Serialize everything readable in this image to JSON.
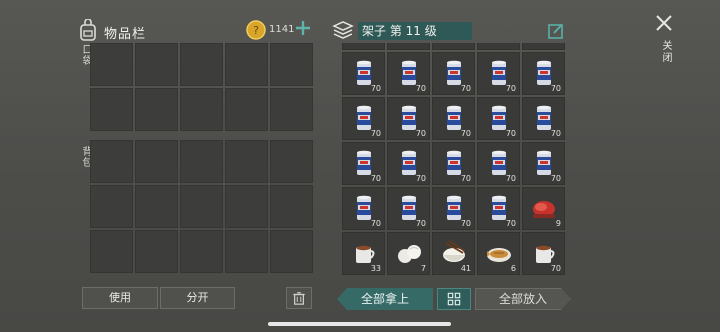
{
  "inventory": {
    "title": "物品栏",
    "coins": "1141",
    "pocket_label": "口袋",
    "backpack_label": "背包"
  },
  "actions": {
    "use": "使用",
    "split": "分开"
  },
  "shelf": {
    "title": "架子 第 11 级",
    "take_all": "全部拿上",
    "put_all": "全部放入",
    "items": [
      {
        "icon": "can",
        "qty": ""
      },
      {
        "icon": "can",
        "qty": ""
      },
      {
        "icon": "can",
        "qty": ""
      },
      {
        "icon": "can",
        "qty": ""
      },
      {
        "icon": "can",
        "qty": ""
      },
      {
        "icon": "can",
        "qty": "70"
      },
      {
        "icon": "can",
        "qty": "70"
      },
      {
        "icon": "can",
        "qty": "70"
      },
      {
        "icon": "can",
        "qty": "70"
      },
      {
        "icon": "can",
        "qty": "70"
      },
      {
        "icon": "can",
        "qty": "70"
      },
      {
        "icon": "can",
        "qty": "70"
      },
      {
        "icon": "can",
        "qty": "70"
      },
      {
        "icon": "can",
        "qty": "70"
      },
      {
        "icon": "can",
        "qty": "70"
      },
      {
        "icon": "can",
        "qty": "70"
      },
      {
        "icon": "can",
        "qty": "70"
      },
      {
        "icon": "can",
        "qty": "70"
      },
      {
        "icon": "can",
        "qty": "70"
      },
      {
        "icon": "can",
        "qty": "70"
      },
      {
        "icon": "can",
        "qty": "70"
      },
      {
        "icon": "can",
        "qty": "70"
      },
      {
        "icon": "can",
        "qty": "70"
      },
      {
        "icon": "can",
        "qty": "70"
      },
      {
        "icon": "meat",
        "qty": "9"
      },
      {
        "icon": "tea-mug",
        "qty": "33"
      },
      {
        "icon": "dumplings",
        "qty": "7"
      },
      {
        "icon": "rice-bowl",
        "qty": "41"
      },
      {
        "icon": "fish-plate",
        "qty": "6"
      },
      {
        "icon": "tea-mug",
        "qty": "70"
      }
    ]
  },
  "close": {
    "label": "关闭"
  },
  "colors": {
    "accent": "#356a66",
    "title_bg": "#2f5956"
  }
}
